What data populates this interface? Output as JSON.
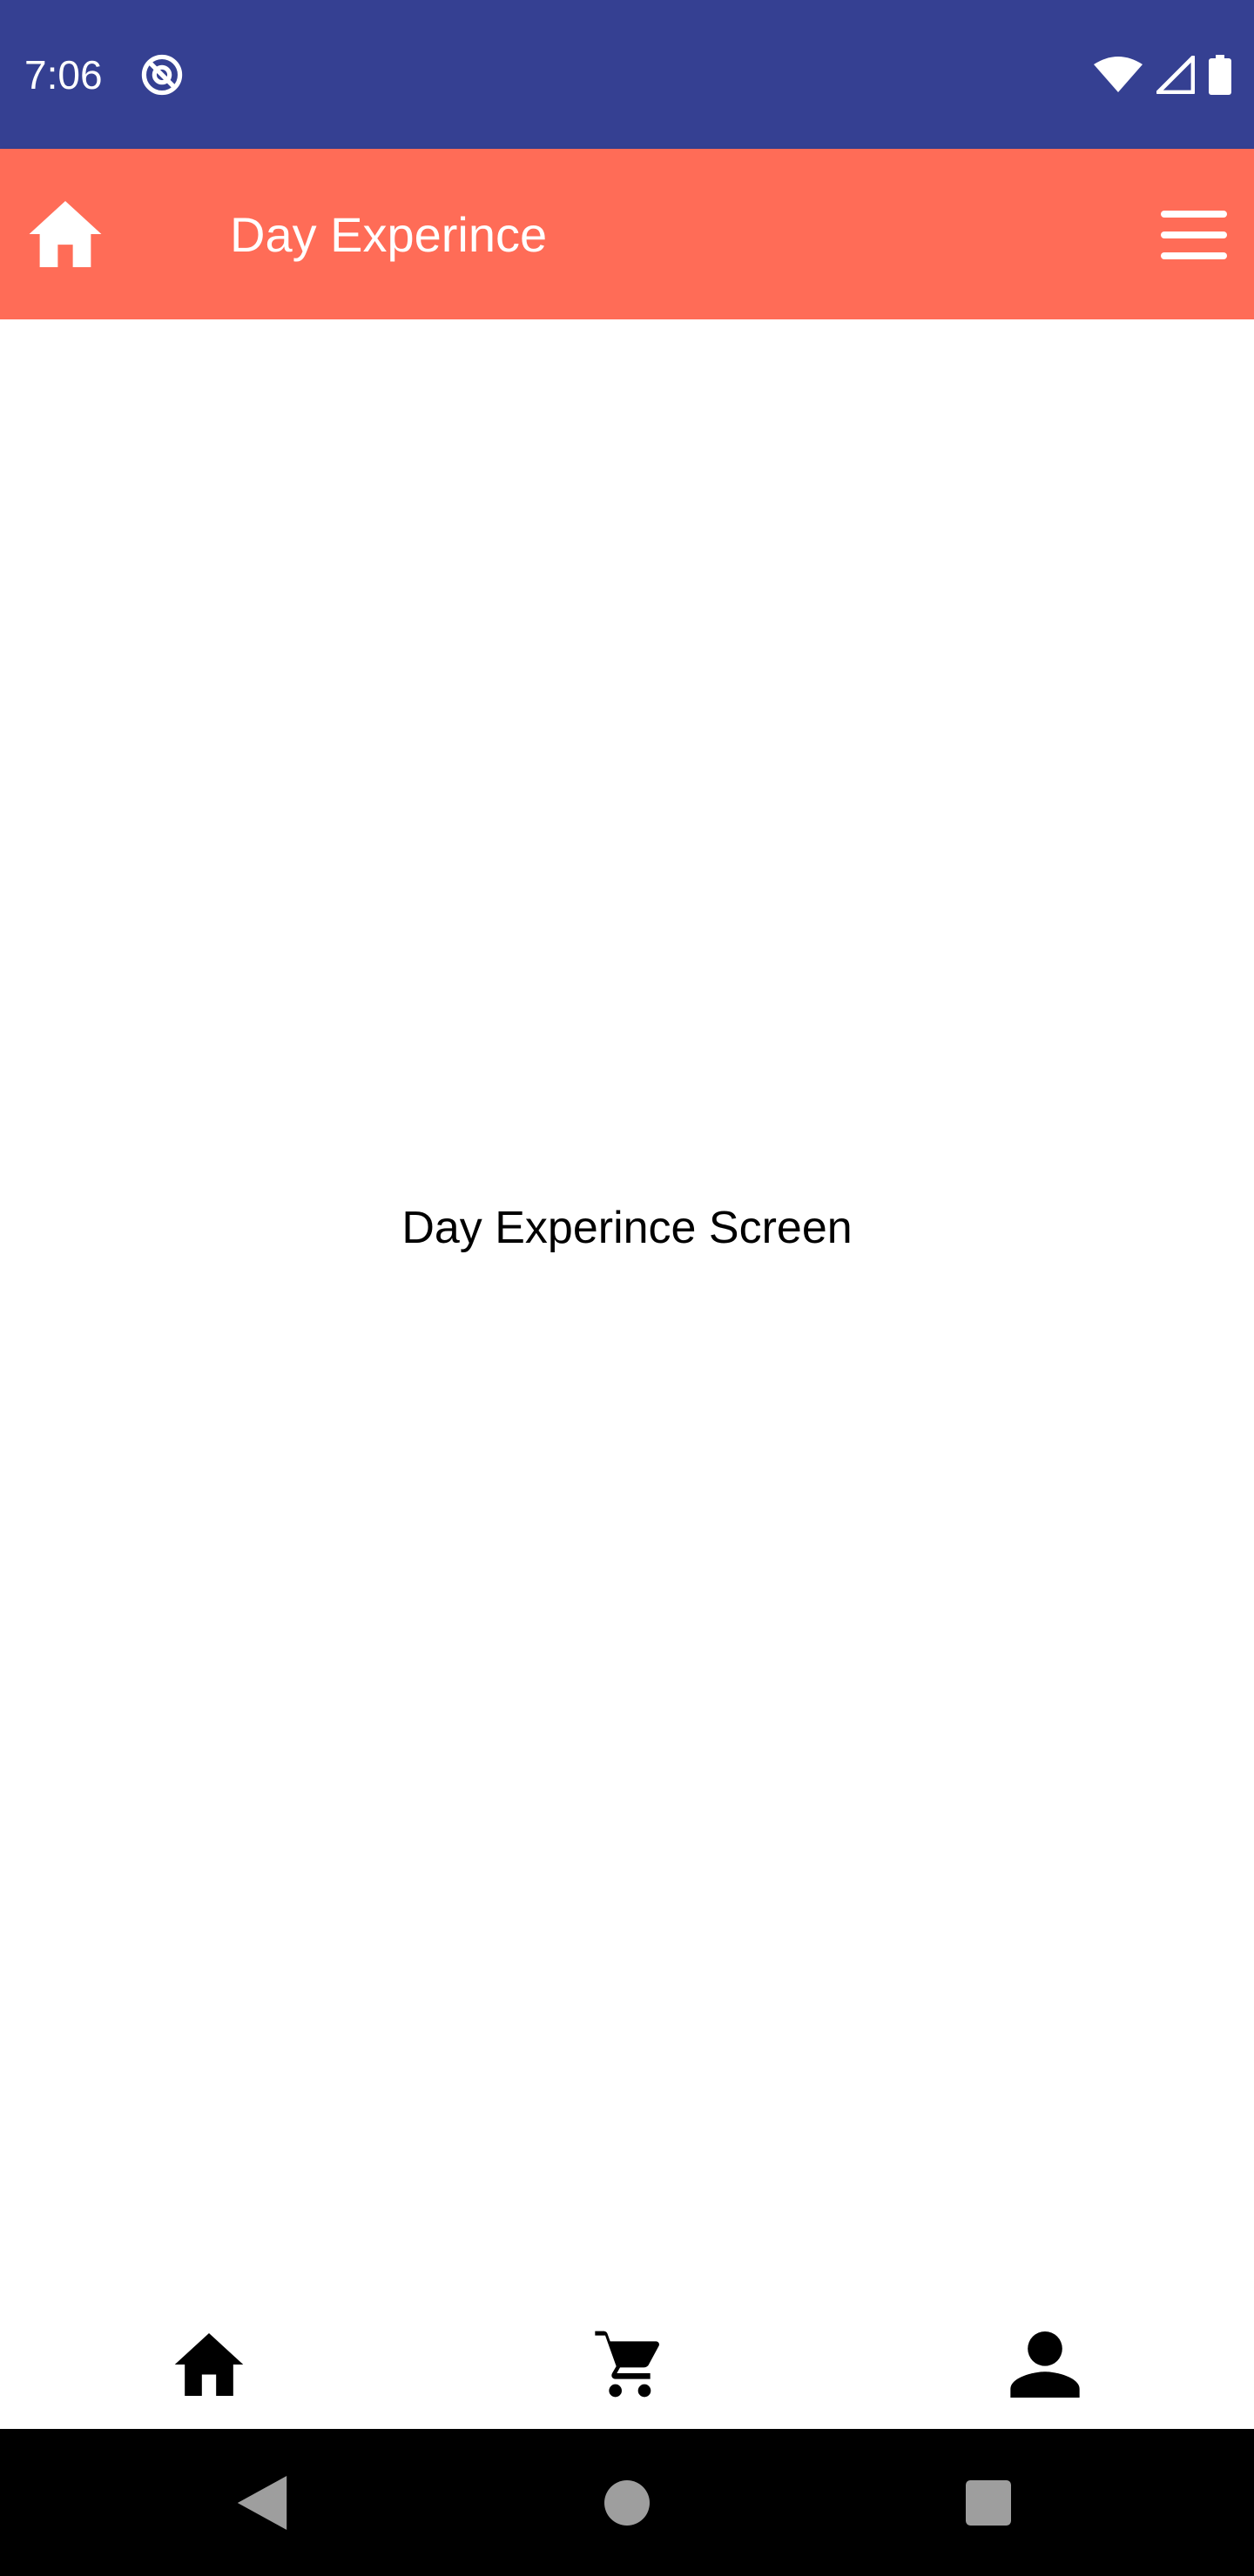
{
  "status_bar": {
    "time": "7:06",
    "background": "#354092",
    "icons": [
      "at-sign-icon",
      "wifi-icon",
      "signal-icon",
      "battery-icon"
    ]
  },
  "app_bar": {
    "title": "Day Experince",
    "background": "#ff6c57",
    "left_icon": "home-icon",
    "right_icon": "hamburger-menu-icon"
  },
  "main": {
    "label": "Day Experince Screen"
  },
  "bottom_nav": {
    "items": [
      {
        "icon": "home-icon"
      },
      {
        "icon": "cart-icon"
      },
      {
        "icon": "person-icon"
      }
    ]
  },
  "system_nav": {
    "buttons": [
      "back-icon",
      "home-circle-icon",
      "recents-square-icon"
    ]
  }
}
